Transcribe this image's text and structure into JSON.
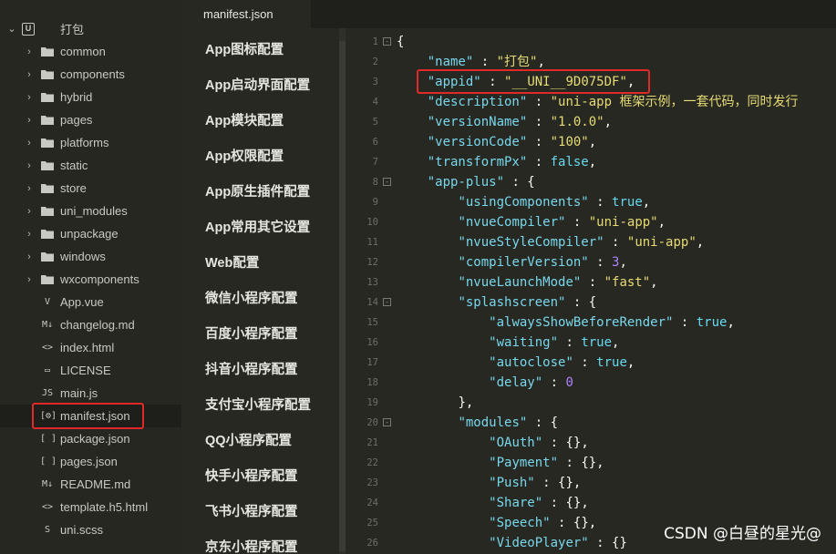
{
  "explorer": {
    "project": "打包",
    "folders": [
      "common",
      "components",
      "hybrid",
      "pages",
      "platforms",
      "static",
      "store",
      "uni_modules",
      "unpackage",
      "windows",
      "wxcomponents"
    ],
    "files": [
      {
        "icon": "V",
        "name": "App.vue"
      },
      {
        "icon": "M↓",
        "name": "changelog.md"
      },
      {
        "icon": "<>",
        "name": "index.html"
      },
      {
        "icon": "▭",
        "name": "LICENSE"
      },
      {
        "icon": "JS",
        "name": "main.js"
      },
      {
        "icon": "[⚙]",
        "name": "manifest.json"
      },
      {
        "icon": "[ ]",
        "name": "package.json"
      },
      {
        "icon": "[ ]",
        "name": "pages.json"
      },
      {
        "icon": "M↓",
        "name": "README.md"
      },
      {
        "icon": "<>",
        "name": "template.h5.html"
      },
      {
        "icon": "S",
        "name": "uni.scss"
      }
    ]
  },
  "tabs": [
    {
      "label": "manifest.json"
    }
  ],
  "settings_nav": [
    "App图标配置",
    "App启动界面配置",
    "App模块配置",
    "App权限配置",
    "App原生插件配置",
    "App常用其它设置",
    "Web配置",
    "微信小程序配置",
    "百度小程序配置",
    "抖音小程序配置",
    "支付宝小程序配置",
    "QQ小程序配置",
    "快手小程序配置",
    "飞书小程序配置",
    "京东小程序配置"
  ],
  "code": {
    "l1": "1",
    "l2": "2",
    "l3": "3",
    "l4": "4",
    "l5": "5",
    "l6": "6",
    "l7": "7",
    "l8": "8",
    "l9": "9",
    "l10": "10",
    "l11": "11",
    "l12": "12",
    "l13": "13",
    "l14": "14",
    "l15": "15",
    "l16": "16",
    "l17": "17",
    "l18": "18",
    "l19": "19",
    "l20": "20",
    "l21": "21",
    "l22": "22",
    "l23": "23",
    "l24": "24",
    "l25": "25",
    "l26": "26",
    "open": "{",
    "name_key": "\"name\"",
    "name_val": "\"打包\"",
    "appid_key": "\"appid\"",
    "appid_val": "\"__UNI__9D075DF\"",
    "desc_key": "\"description\"",
    "desc_val": "\"uni-app 框架示例，一套代码，同时发行",
    "vname_key": "\"versionName\"",
    "vname_val": "\"1.0.0\"",
    "vcode_key": "\"versionCode\"",
    "vcode_val": "\"100\"",
    "tpx_key": "\"transformPx\"",
    "tpx_val": "false",
    "ap_key": "\"app-plus\"",
    "uc_key": "\"usingComponents\"",
    "uc_val": "true",
    "nc_key": "\"nvueCompiler\"",
    "nc_val": "\"uni-app\"",
    "nsc_key": "\"nvueStyleCompiler\"",
    "nsc_val": "\"uni-app\"",
    "cv_key": "\"compilerVersion\"",
    "cv_val": "3",
    "nlm_key": "\"nvueLaunchMode\"",
    "nlm_val": "\"fast\"",
    "ss_key": "\"splashscreen\"",
    "asbr_key": "\"alwaysShowBeforeRender\"",
    "asbr_val": "true",
    "wait_key": "\"waiting\"",
    "wait_val": "true",
    "ac_key": "\"autoclose\"",
    "ac_val": "true",
    "delay_key": "\"delay\"",
    "delay_val": "0",
    "close_brace": "},",
    "mod_key": "\"modules\"",
    "oauth_key": "\"OAuth\"",
    "pay_key": "\"Payment\"",
    "push_key": "\"Push\"",
    "share_key": "\"Share\"",
    "speech_key": "\"Speech\"",
    "vp_key": "\"VideoPlayer\"",
    "empty_obj": "{}"
  },
  "watermark": "CSDN @白昼的星光@"
}
